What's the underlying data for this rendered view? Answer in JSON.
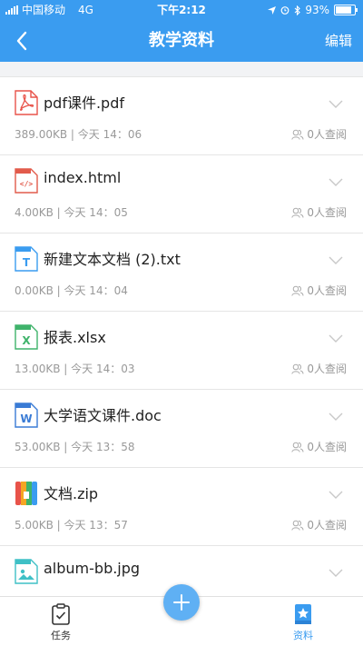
{
  "status_bar": {
    "carrier": "中国移动",
    "network": "4G",
    "time": "下午2:12",
    "battery": "93%"
  },
  "nav": {
    "title": "教学资料",
    "edit_label": "编辑"
  },
  "files": [
    {
      "name": "pdf课件.pdf",
      "meta": "389.00KB | 今天 14：06",
      "views": "0人查阅",
      "icon": "pdf-icon",
      "color": "#e8534a"
    },
    {
      "name": "index.html",
      "meta": "4.00KB | 今天 14：05",
      "views": "0人查阅",
      "icon": "html-icon",
      "color": "#e25b4b"
    },
    {
      "name": "新建文本文档 (2).txt",
      "meta": "0.00KB | 今天 14：04",
      "views": "0人查阅",
      "icon": "txt-icon",
      "color": "#3a9cf0"
    },
    {
      "name": "报表.xlsx",
      "meta": "13.00KB | 今天 14：03",
      "views": "0人查阅",
      "icon": "excel-icon",
      "color": "#3fb36b"
    },
    {
      "name": "大学语文课件.doc",
      "meta": "53.00KB | 今天 13：58",
      "views": "0人查阅",
      "icon": "word-icon",
      "color": "#3a7bd5"
    },
    {
      "name": "文档.zip",
      "meta": "5.00KB | 今天 13：57",
      "views": "0人查阅",
      "icon": "zip-icon",
      "color": "#f5a623"
    },
    {
      "name": "album-bb.jpg",
      "meta": "",
      "views": "",
      "icon": "image-icon",
      "color": "#3fc0c6"
    }
  ],
  "tabbar": {
    "tasks_label": "任务",
    "resources_label": "资料"
  },
  "colors": {
    "primary": "#3a9cf0",
    "fab": "#5fb0f4"
  }
}
